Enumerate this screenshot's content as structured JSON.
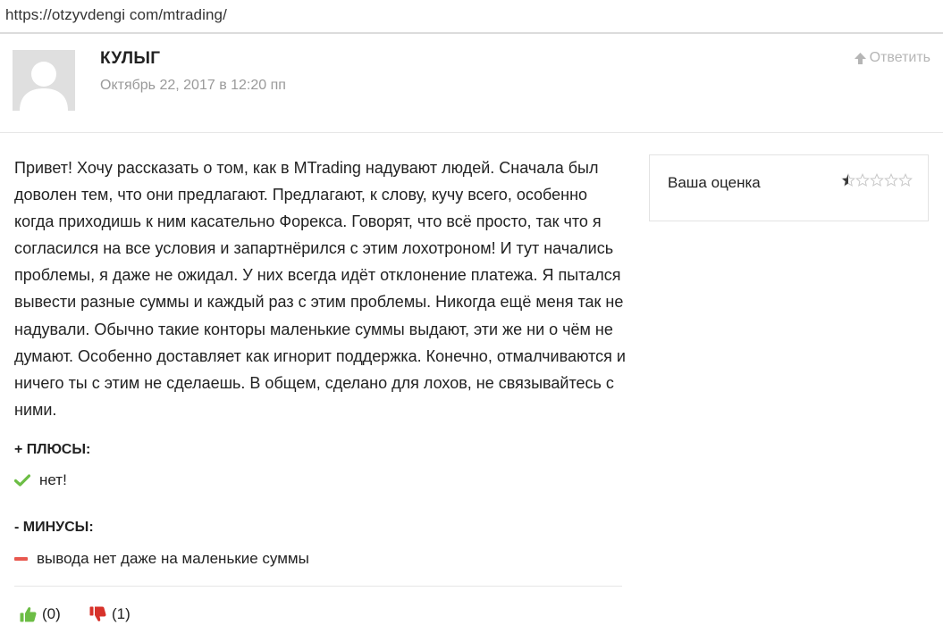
{
  "browser": {
    "url": "https://otzyvdengi com/mtrading/"
  },
  "comment": {
    "author": "КУЛЫГ",
    "date": "Октябрь 22, 2017 в 12:20 пп",
    "reply_label": "Ответить",
    "text": "Привет! Хочу рассказать о том, как в MTrading надувают людей. Сначала был доволен тем, что они предлагают. Предлагают, к слову, кучу всего, особенно когда приходишь к ним касательно Форекса. Говорят, что всё просто, так что я согласился на все условия и запартнёрился с этим лохотроном! И тут начались проблемы, я даже не ожидал. У них всегда идёт отклонение платежа. Я пытался вывести разные суммы и каждый раз с этим проблемы. Никогда ещё меня так не надували. Обычно такие конторы маленькие суммы выдают, эти же ни о чём не думают. Особенно доставляет как игнорит поддержка. Конечно, отмалчиваются и ничего ты с этим не сделаешь. В общем, сделано для лохов, не связывайтесь с ними.",
    "pros_title": "+ ПЛЮСЫ:",
    "pros": [
      "нет!"
    ],
    "cons_title": "- МИНУСЫ:",
    "cons": [
      "вывода нет даже на маленькие суммы"
    ],
    "likes": "(0)",
    "dislikes": "(1)"
  },
  "rating": {
    "label": "Ваша оценка",
    "value": 0.5,
    "max": 5
  },
  "icons": {
    "reply": "arrow-up-icon",
    "pros": "checkmark-icon",
    "cons": "minus-icon",
    "like": "thumbs-up-icon",
    "dislike": "thumbs-down-icon",
    "star": "star-icon"
  },
  "colors": {
    "check": "#6cbd45",
    "minus": "#e8584f",
    "like": "#6cbd45",
    "dislike": "#d7322a",
    "star_fill": "#3a3a3a",
    "star_empty": "#c8c8c8",
    "muted": "#9a9a9a"
  }
}
